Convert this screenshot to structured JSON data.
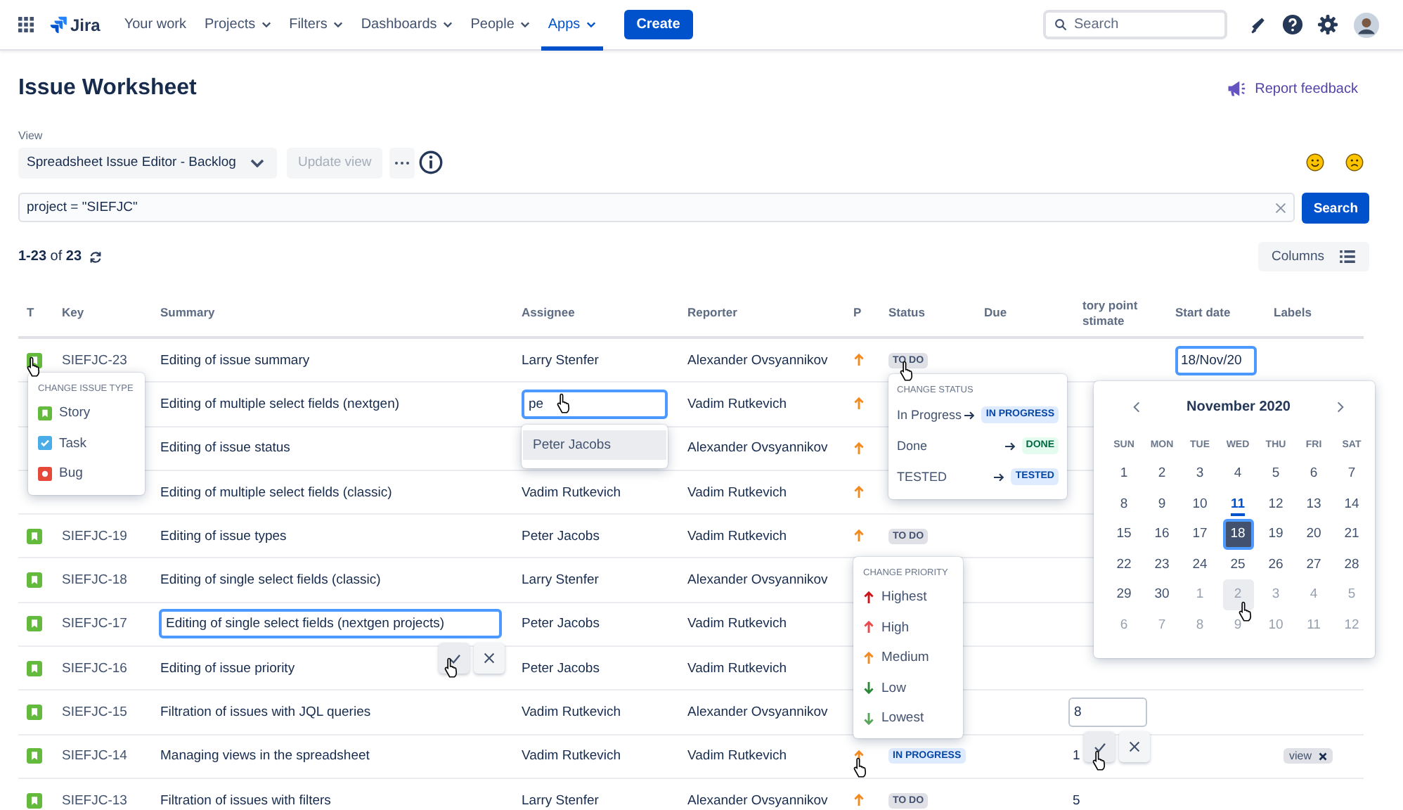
{
  "nav": {
    "brand": "Jira",
    "items": [
      {
        "label": "Your work",
        "dropdown": false,
        "selected": false
      },
      {
        "label": "Projects",
        "dropdown": true,
        "selected": false
      },
      {
        "label": "Filters",
        "dropdown": true,
        "selected": false
      },
      {
        "label": "Dashboards",
        "dropdown": true,
        "selected": false
      },
      {
        "label": "People",
        "dropdown": true,
        "selected": false
      },
      {
        "label": "Apps",
        "dropdown": true,
        "selected": true
      }
    ],
    "create": "Create",
    "search": {
      "placeholder": "Search"
    }
  },
  "page": {
    "title": "Issue Worksheet",
    "feedback": "Report feedback"
  },
  "view": {
    "label": "View",
    "selected": "Spreadsheet Issue Editor - Backlog",
    "update_button": {
      "label": "Update view",
      "disabled": true
    }
  },
  "query": {
    "value": "project = \"SIEFJC\"",
    "button": "Search"
  },
  "count": "**1-23** of **23**",
  "columns_button": "Columns",
  "table": {
    "columns": [
      "T",
      "Key",
      "Summary",
      "Assignee",
      "Reporter",
      "P",
      "Status",
      "Due",
      "tory point stimate",
      "Start date",
      "Labels"
    ],
    "rows": [
      {
        "kind": "story",
        "key": "SIEFJC-23",
        "summary": "Editing of issue summary",
        "assignee": "Larry Stenfer",
        "reporter": "Alexander Ovsyannikov",
        "priority": {
          "kind": "medium"
        },
        "status": {
          "text": "TO DO",
          "kind": "todo"
        },
        "start_date": {
          "text": "18/Nov/20",
          "kind": "input",
          "confirm": false
        }
      },
      {
        "summary": "Editing of multiple select fields (nextgen)",
        "assignee": {
          "text": "pe",
          "kind": "input",
          "confirm": false
        },
        "reporter": "Vadim Rutkevich",
        "priority": {
          "kind": "medium"
        }
      },
      {
        "summary": "Editing of issue status",
        "reporter": "Alexander Ovsyannikov",
        "priority": {
          "kind": "medium"
        }
      },
      {
        "summary": "Editing of multiple select fields (classic)",
        "assignee": "Vadim Rutkevich",
        "reporter": "Vadim Rutkevich",
        "priority": {
          "kind": "medium"
        }
      },
      {
        "kind": "story",
        "key": "SIEFJC-19",
        "summary": "Editing of issue types",
        "assignee": "Peter Jacobs",
        "reporter": "Vadim Rutkevich",
        "priority": {
          "kind": "medium"
        },
        "status": {
          "text": "TO DO",
          "kind": "todo"
        }
      },
      {
        "kind": "story",
        "key": "SIEFJC-18",
        "summary": "Editing of single select fields (classic)",
        "assignee": "Larry Stenfer",
        "reporter": "Alexander Ovsyannikov"
      },
      {
        "kind": "story",
        "key": "SIEFJC-17",
        "summary": {
          "text": "Editing of single select fields (nextgen projects)",
          "kind": "input",
          "confirm": true
        },
        "assignee": "Peter Jacobs",
        "reporter": "Vadim Rutkevich"
      },
      {
        "kind": "story",
        "key": "SIEFJC-16",
        "summary": "Editing of issue priority",
        "assignee": "Peter Jacobs",
        "reporter": "Vadim Rutkevich"
      },
      {
        "kind": "story",
        "key": "SIEFJC-15",
        "summary": "Filtration of issues with JQL queries",
        "assignee": "Vadim Rutkevich",
        "reporter": "Alexander Ovsyannikov",
        "story_points": {
          "text": "8",
          "kind": "input",
          "confirm": true
        }
      },
      {
        "kind": "story",
        "key": "SIEFJC-14",
        "summary": "Managing views in the spreadsheet",
        "assignee": "Vadim Rutkevich",
        "reporter": "Vadim Rutkevich",
        "priority": {
          "kind": "medium"
        },
        "status": {
          "text": "IN PROGRESS",
          "kind": "inprogress"
        },
        "story_points": "1",
        "labels": [
          "view"
        ]
      },
      {
        "kind": "story",
        "key": "SIEFJC-13",
        "summary": "Filtration of issues with filters",
        "assignee": "Larry Stenfer",
        "reporter": "Alexander Ovsyannikov",
        "priority": {
          "kind": "medium"
        },
        "status": {
          "text": "TO DO",
          "kind": "todo"
        },
        "story_points": "5"
      }
    ]
  },
  "issue_type_menu": {
    "title": "CHANGE ISSUE TYPE",
    "items": [
      {
        "label": "Story",
        "kind": "story"
      },
      {
        "label": "Task",
        "kind": "task"
      },
      {
        "label": "Bug",
        "kind": "bug"
      }
    ]
  },
  "assignee_suggestions": [
    {
      "label": "Peter Jacobs",
      "selected": true
    }
  ],
  "status_menu": {
    "title": "CHANGE STATUS",
    "items": [
      {
        "label": "In Progress",
        "status": {
          "text": "IN PROGRESS",
          "kind": "inprogress"
        }
      },
      {
        "label": "Done",
        "status": {
          "text": "DONE",
          "kind": "done"
        }
      },
      {
        "label": "TESTED",
        "status": {
          "text": "TESTED",
          "kind": "tested"
        }
      }
    ]
  },
  "calendar": {
    "title": "November 2020",
    "weekdays": [
      "SUN",
      "MON",
      "TUE",
      "WED",
      "THU",
      "FRI",
      "SAT"
    ],
    "weeks": [
      [
        {
          "day": "1",
          "outside": false,
          "today": false,
          "selected": false,
          "hovered": false
        },
        {
          "day": "2",
          "outside": false,
          "today": false,
          "selected": false,
          "hovered": false
        },
        {
          "day": "3",
          "outside": false,
          "today": false,
          "selected": false,
          "hovered": false
        },
        {
          "day": "4",
          "outside": false,
          "today": false,
          "selected": false,
          "hovered": false
        },
        {
          "day": "5",
          "outside": false,
          "today": false,
          "selected": false,
          "hovered": false
        },
        {
          "day": "6",
          "outside": false,
          "today": false,
          "selected": false,
          "hovered": false
        },
        {
          "day": "7",
          "outside": false,
          "today": false,
          "selected": false,
          "hovered": false
        }
      ],
      [
        {
          "day": "8",
          "outside": false,
          "today": false,
          "selected": false,
          "hovered": false
        },
        {
          "day": "9",
          "outside": false,
          "today": false,
          "selected": false,
          "hovered": false
        },
        {
          "day": "10",
          "outside": false,
          "today": false,
          "selected": false,
          "hovered": false
        },
        {
          "day": "11",
          "outside": false,
          "today": true,
          "selected": false,
          "hovered": false
        },
        {
          "day": "12",
          "outside": false,
          "today": false,
          "selected": false,
          "hovered": false
        },
        {
          "day": "13",
          "outside": false,
          "today": false,
          "selected": false,
          "hovered": false
        },
        {
          "day": "14",
          "outside": false,
          "today": false,
          "selected": false,
          "hovered": false
        }
      ],
      [
        {
          "day": "15",
          "outside": false,
          "today": false,
          "selected": false,
          "hovered": false
        },
        {
          "day": "16",
          "outside": false,
          "today": false,
          "selected": false,
          "hovered": false
        },
        {
          "day": "17",
          "outside": false,
          "today": false,
          "selected": false,
          "hovered": false
        },
        {
          "day": "18",
          "outside": false,
          "today": false,
          "selected": true,
          "hovered": false
        },
        {
          "day": "19",
          "outside": false,
          "today": false,
          "selected": false,
          "hovered": false
        },
        {
          "day": "20",
          "outside": false,
          "today": false,
          "selected": false,
          "hovered": false
        },
        {
          "day": "21",
          "outside": false,
          "today": false,
          "selected": false,
          "hovered": false
        }
      ],
      [
        {
          "day": "22",
          "outside": false,
          "today": false,
          "selected": false,
          "hovered": false
        },
        {
          "day": "23",
          "outside": false,
          "today": false,
          "selected": false,
          "hovered": false
        },
        {
          "day": "24",
          "outside": false,
          "today": false,
          "selected": false,
          "hovered": false
        },
        {
          "day": "25",
          "outside": false,
          "today": false,
          "selected": false,
          "hovered": false
        },
        {
          "day": "26",
          "outside": false,
          "today": false,
          "selected": false,
          "hovered": false
        },
        {
          "day": "27",
          "outside": false,
          "today": false,
          "selected": false,
          "hovered": false
        },
        {
          "day": "28",
          "outside": false,
          "today": false,
          "selected": false,
          "hovered": false
        }
      ],
      [
        {
          "day": "29",
          "outside": false,
          "today": false,
          "selected": false,
          "hovered": false
        },
        {
          "day": "30",
          "outside": false,
          "today": false,
          "selected": false,
          "hovered": false
        },
        {
          "day": "1",
          "outside": true,
          "today": false,
          "selected": false,
          "hovered": false
        },
        {
          "day": "2",
          "outside": true,
          "today": false,
          "selected": false,
          "hovered": true
        },
        {
          "day": "3",
          "outside": true,
          "today": false,
          "selected": false,
          "hovered": false
        },
        {
          "day": "4",
          "outside": true,
          "today": false,
          "selected": false,
          "hovered": false
        },
        {
          "day": "5",
          "outside": true,
          "today": false,
          "selected": false,
          "hovered": false
        }
      ],
      [
        {
          "day": "6",
          "outside": true,
          "today": false,
          "selected": false,
          "hovered": false
        },
        {
          "day": "7",
          "outside": true,
          "today": false,
          "selected": false,
          "hovered": false
        },
        {
          "day": "8",
          "outside": true,
          "today": false,
          "selected": false,
          "hovered": false
        },
        {
          "day": "9",
          "outside": true,
          "today": false,
          "selected": false,
          "hovered": false
        },
        {
          "day": "10",
          "outside": true,
          "today": false,
          "selected": false,
          "hovered": false
        },
        {
          "day": "11",
          "outside": true,
          "today": false,
          "selected": false,
          "hovered": false
        },
        {
          "day": "12",
          "outside": true,
          "today": false,
          "selected": false,
          "hovered": false
        }
      ]
    ]
  },
  "priority_menu": {
    "title": "CHANGE PRIORITY",
    "items": [
      {
        "label": "Highest",
        "kind": "highest"
      },
      {
        "label": "High",
        "kind": "high"
      },
      {
        "label": "Medium",
        "kind": "medium"
      },
      {
        "label": "Low",
        "kind": "low"
      },
      {
        "label": "Lowest",
        "kind": "lowest"
      }
    ]
  }
}
